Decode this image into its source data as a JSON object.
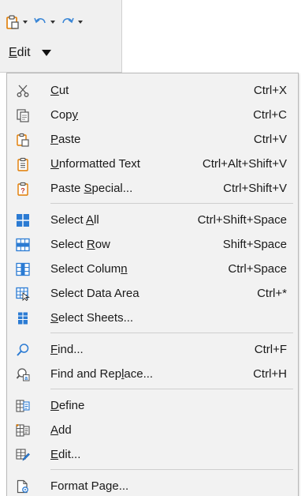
{
  "toolbar": {
    "edit_label": "Edit",
    "buttons": [
      {
        "icon": "paste-icon"
      },
      {
        "icon": "undo-icon"
      },
      {
        "icon": "redo-icon"
      }
    ]
  },
  "menu": {
    "items": [
      {
        "label": "Cut",
        "shortcut": "Ctrl+X",
        "icon": "cut-icon"
      },
      {
        "label": "Copy",
        "shortcut": "Ctrl+C",
        "icon": "copy-icon"
      },
      {
        "label": "Paste",
        "shortcut": "Ctrl+V",
        "icon": "paste-icon"
      },
      {
        "label": "Unformatted Text",
        "shortcut": "Ctrl+Alt+Shift+V",
        "icon": "unformatted-text-icon"
      },
      {
        "label": "Paste Special...",
        "shortcut": "Ctrl+Shift+V",
        "icon": "paste-special-icon"
      },
      {
        "label": "Select All",
        "shortcut": "Ctrl+Shift+Space",
        "icon": "select-all-icon"
      },
      {
        "label": "Select Row",
        "shortcut": "Shift+Space",
        "icon": "select-row-icon"
      },
      {
        "label": "Select Column",
        "shortcut": "Ctrl+Space",
        "icon": "select-column-icon"
      },
      {
        "label": "Select Data Area",
        "shortcut": "Ctrl+*",
        "icon": "select-data-area-icon"
      },
      {
        "label": "Select Sheets...",
        "shortcut": "",
        "icon": "select-sheets-icon"
      },
      {
        "label": "Find...",
        "shortcut": "Ctrl+F",
        "icon": "find-icon"
      },
      {
        "label": "Find and Replace...",
        "shortcut": "Ctrl+H",
        "icon": "find-replace-icon"
      },
      {
        "label": "Define",
        "shortcut": "",
        "icon": "define-name-icon"
      },
      {
        "label": "Add",
        "shortcut": "",
        "icon": "add-name-icon"
      },
      {
        "label": "Edit...",
        "shortcut": "",
        "icon": "edit-name-icon"
      },
      {
        "label": "Format Page...",
        "shortcut": "",
        "icon": "format-page-icon"
      }
    ]
  }
}
